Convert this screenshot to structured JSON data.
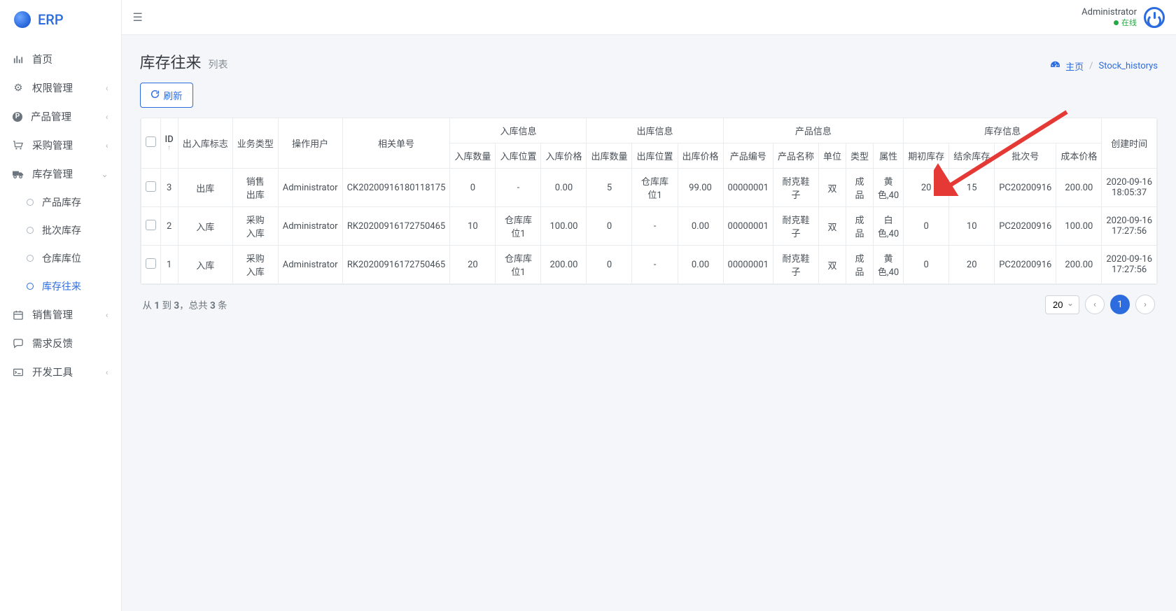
{
  "brand": "ERP",
  "user": {
    "name": "Administrator",
    "status": "在线"
  },
  "sidebar": {
    "items": [
      {
        "label": "首页",
        "icon": "bars"
      },
      {
        "label": "权限管理",
        "icon": "gear",
        "chev": true
      },
      {
        "label": "产品管理",
        "icon": "p",
        "chev": true
      },
      {
        "label": "采购管理",
        "icon": "cart",
        "chev": true
      },
      {
        "label": "库存管理",
        "icon": "truck",
        "chev": true,
        "expanded": true,
        "children": [
          {
            "label": "产品库存"
          },
          {
            "label": "批次库存"
          },
          {
            "label": "仓库库位"
          },
          {
            "label": "库存往来",
            "active": true
          }
        ]
      },
      {
        "label": "销售管理",
        "icon": "calendar",
        "chev": true
      },
      {
        "label": "需求反馈",
        "icon": "chat"
      },
      {
        "label": "开发工具",
        "icon": "terminal",
        "chev": true
      }
    ]
  },
  "page": {
    "title": "库存往来",
    "subtitle": "列表",
    "breadcrumb_home": "主页",
    "breadcrumb_current": "Stock_historys",
    "refresh": "刷新"
  },
  "table": {
    "groups": [
      "入库信息",
      "出库信息",
      "产品信息",
      "库存信息"
    ],
    "headers": {
      "id": "ID",
      "io_flag": "出入库标志",
      "biz_type": "业务类型",
      "operator": "操作用户",
      "related_no": "相关单号",
      "in_qty": "入库数量",
      "in_loc": "入库位置",
      "in_price": "入库价格",
      "out_qty": "出库数量",
      "out_loc": "出库位置",
      "out_price": "出库价格",
      "prod_code": "产品编号",
      "prod_name": "产品名称",
      "unit": "单位",
      "type": "类型",
      "attr": "属性",
      "begin_stock": "期初库存",
      "end_stock": "结余库存",
      "batch_no": "批次号",
      "cost_price": "成本价格",
      "created": "创建时间"
    },
    "rows": [
      {
        "id": "3",
        "io_flag": "出库",
        "biz_type": "销售出库",
        "operator": "Administrator",
        "related_no": "CK20200916180118175",
        "in_qty": "0",
        "in_loc": "-",
        "in_price": "0.00",
        "out_qty": "5",
        "out_loc": "仓库库位1",
        "out_price": "99.00",
        "prod_code": "00000001",
        "prod_name": "耐克鞋子",
        "unit": "双",
        "type": "成品",
        "attr": "黄色,40",
        "begin_stock": "20",
        "end_stock": "15",
        "batch_no": "PC20200916",
        "cost_price": "200.00",
        "created": "2020-09-16 18:05:37"
      },
      {
        "id": "2",
        "io_flag": "入库",
        "biz_type": "采购入库",
        "operator": "Administrator",
        "related_no": "RK20200916172750465",
        "in_qty": "10",
        "in_loc": "仓库库位1",
        "in_price": "100.00",
        "out_qty": "0",
        "out_loc": "-",
        "out_price": "0.00",
        "prod_code": "00000001",
        "prod_name": "耐克鞋子",
        "unit": "双",
        "type": "成品",
        "attr": "白色,40",
        "begin_stock": "0",
        "end_stock": "10",
        "batch_no": "PC20200916",
        "cost_price": "100.00",
        "created": "2020-09-16 17:27:56"
      },
      {
        "id": "1",
        "io_flag": "入库",
        "biz_type": "采购入库",
        "operator": "Administrator",
        "related_no": "RK20200916172750465",
        "in_qty": "20",
        "in_loc": "仓库库位1",
        "in_price": "200.00",
        "out_qty": "0",
        "out_loc": "-",
        "out_price": "0.00",
        "prod_code": "00000001",
        "prod_name": "耐克鞋子",
        "unit": "双",
        "type": "成品",
        "attr": "黄色,40",
        "begin_stock": "0",
        "end_stock": "20",
        "batch_no": "PC20200916",
        "cost_price": "200.00",
        "created": "2020-09-16 17:27:56"
      }
    ]
  },
  "footer": {
    "summary_prefix": "从 ",
    "summary_from": "1",
    "summary_mid1": " 到 ",
    "summary_to": "3",
    "summary_mid2": "，总共 ",
    "summary_total": "3",
    "summary_suffix": " 条",
    "page_size": "20",
    "current_page": "1"
  }
}
